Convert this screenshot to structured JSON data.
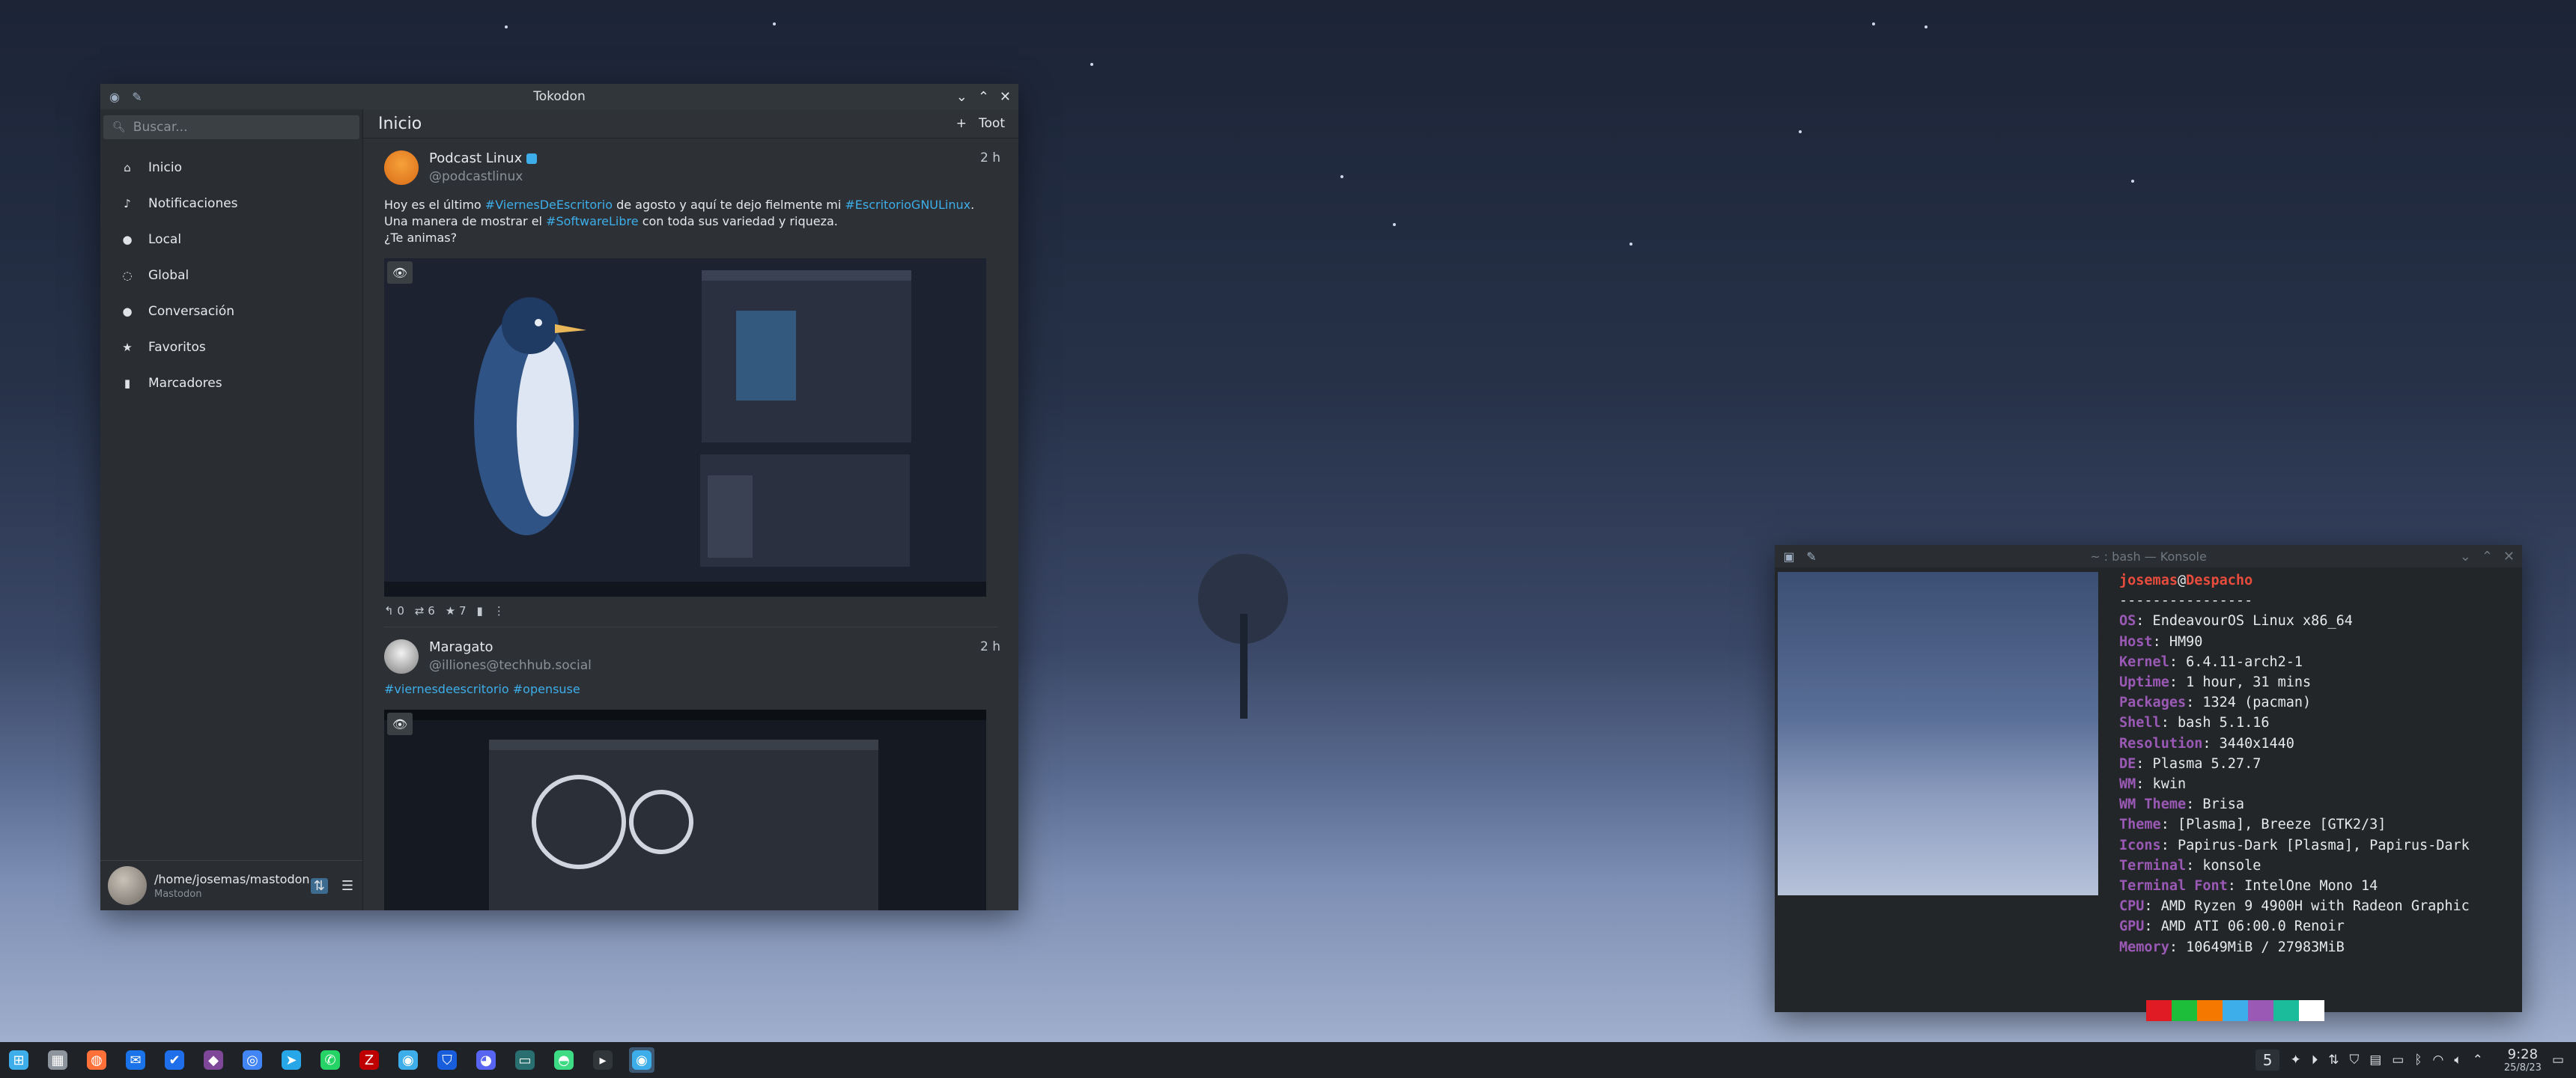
{
  "tokodon": {
    "window_title": "Tokodon",
    "search_placeholder": "Buscar...",
    "nav": [
      {
        "label": "Inicio",
        "icon": "home-icon"
      },
      {
        "label": "Notificaciones",
        "icon": "bell-icon"
      },
      {
        "label": "Local",
        "icon": "circle-icon"
      },
      {
        "label": "Global",
        "icon": "globe-icon"
      },
      {
        "label": "Conversación",
        "icon": "circle-icon"
      },
      {
        "label": "Favoritos",
        "icon": "star-icon"
      },
      {
        "label": "Marcadores",
        "icon": "bookmark-icon"
      }
    ],
    "account": {
      "path": "/home/josemas/mastodon",
      "sub": "Mastodon"
    },
    "header": {
      "title": "Inicio",
      "toot_label": "Toot"
    },
    "posts": [
      {
        "name": "Podcast Linux",
        "handle": "@podcastlinux",
        "time": "2 h",
        "line1_a": "Hoy es el último ",
        "line1_tag1": "#ViernesDeEscritorio",
        "line1_b": " de agosto y aquí te dejo fielmente mi ",
        "line1_tag2": "#EscritorioGNULinux",
        "line1_c": ".",
        "line2_a": "Una manera de mostrar el ",
        "line2_tag": "#SoftwareLibre",
        "line2_b": " con toda sus variedad y riqueza.",
        "line3": "¿Te animas?",
        "replies": "0",
        "boosts": "6",
        "favs": "7"
      },
      {
        "name": "Maragato",
        "handle": "@illiones@techhub.social",
        "time": "2 h",
        "tags": "#viernesdeescritorio #opensuse"
      }
    ]
  },
  "konsole": {
    "window_title": "~ : bash — Konsole",
    "user": "josemas",
    "host": "Despacho",
    "separator": "----------------",
    "rows": [
      {
        "key": "OS",
        "value": "EndeavourOS Linux x86_64"
      },
      {
        "key": "Host",
        "value": "HM90"
      },
      {
        "key": "Kernel",
        "value": "6.4.11-arch2-1"
      },
      {
        "key": "Uptime",
        "value": "1 hour, 31 mins"
      },
      {
        "key": "Packages",
        "value": "1324 (pacman)"
      },
      {
        "key": "Shell",
        "value": "bash 5.1.16"
      },
      {
        "key": "Resolution",
        "value": "3440x1440"
      },
      {
        "key": "DE",
        "value": "Plasma 5.27.7"
      },
      {
        "key": "WM",
        "value": "kwin"
      },
      {
        "key": "WM Theme",
        "value": "Brisa"
      },
      {
        "key": "Theme",
        "value": "[Plasma], Breeze [GTK2/3]"
      },
      {
        "key": "Icons",
        "value": "Papirus-Dark [Plasma], Papirus-Dark"
      },
      {
        "key": "Terminal",
        "value": "konsole"
      },
      {
        "key": "Terminal Font",
        "value": "IntelOne Mono 14"
      },
      {
        "key": "CPU",
        "value": "AMD Ryzen 9 4900H with Radeon Graphic"
      },
      {
        "key": "GPU",
        "value": "AMD ATI 06:00.0 Renoir"
      },
      {
        "key": "Memory",
        "value": "10649MiB / 27983MiB"
      }
    ],
    "palette": [
      "#e01b24",
      "#1dbf3a",
      "#f57900",
      "#3daee9",
      "#9b59b6",
      "#1abc9c",
      "#ffffff"
    ]
  },
  "taskbar": {
    "apps": [
      "app-launcher-icon",
      "file-manager-icon",
      "firefox-icon",
      "thunderbird-icon",
      "todo-icon",
      "tor-icon",
      "chrome-icon",
      "telegram-icon",
      "whatsapp-icon",
      "filezilla-icon",
      "tokodon-icon",
      "bitwarden-icon",
      "discord-icon",
      "monitor-icon",
      "android-icon",
      "konsole-icon",
      "tokodon-active-icon"
    ],
    "virtual_desktop": "5",
    "time": "9:28",
    "date": "25/8/23"
  }
}
